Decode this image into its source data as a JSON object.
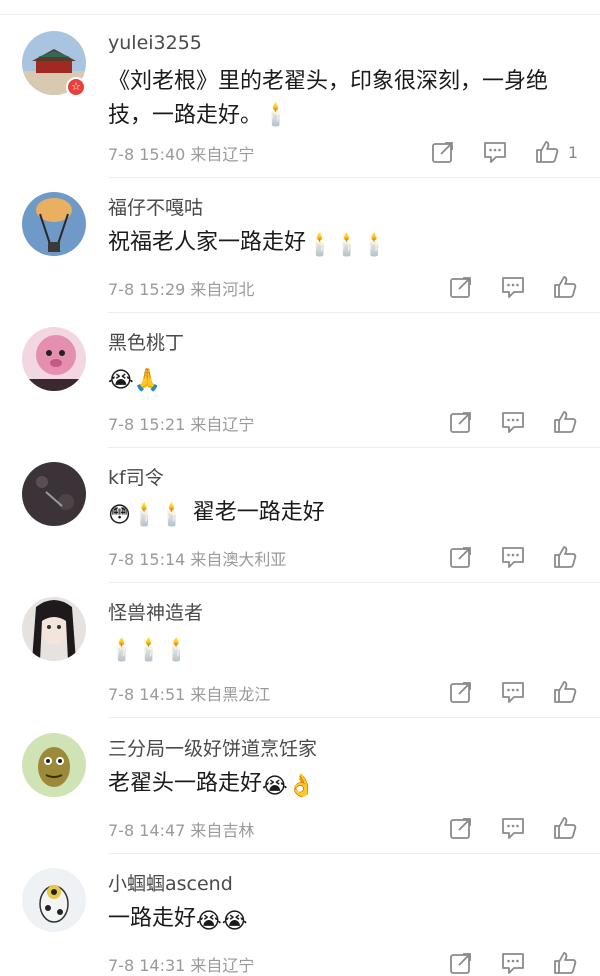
{
  "comments": [
    {
      "username": "yulei3255",
      "text": "《刘老根》里的老翟头，印象很深刻，一身绝技，一路走好。🕯️",
      "time": "7-8 15:40",
      "location": "来自辽宁",
      "likes": "1",
      "avatar_color": "#8fa8c8",
      "has_badge": true,
      "badge_icon": "☆"
    },
    {
      "username": "福仔不嘎咕",
      "text": "祝福老人家一路走好",
      "emojis": "🕯️🕯️🕯️",
      "time": "7-8 15:29",
      "location": "来自河北",
      "likes": "",
      "avatar_color": "#7aa0c8"
    },
    {
      "username": "黑色桃丁",
      "emojis": "😭🙏",
      "time": "7-8 15:21",
      "location": "来自辽宁",
      "likes": "",
      "avatar_color": "#d98fb0"
    },
    {
      "username": "kf司令",
      "emojis": "😳🕯️🕯️",
      "text": "翟老一路走好",
      "time": "7-8 15:14",
      "location": "来自澳大利亚",
      "likes": "",
      "avatar_color": "#3a3438"
    },
    {
      "username": "怪兽神造者",
      "emojis": "🕯️🕯️🕯️",
      "time": "7-8 14:51",
      "location": "来自黑龙江",
      "likes": "",
      "avatar_color": "#d9d5d2"
    },
    {
      "username": "三分局一级好饼道烹饪家",
      "text": "老翟头一路走好",
      "emojis": "😭👌",
      "time": "7-8 14:47",
      "location": "来自吉林",
      "likes": "",
      "avatar_color": "#bcd49a"
    },
    {
      "username": "小蝈蝈ascend",
      "text": "一路走好",
      "emojis": "😭😭",
      "time": "7-8 14:31",
      "location": "来自辽宁",
      "likes": "",
      "avatar_color": "#e8eef2"
    }
  ],
  "icons": {
    "share": "share-icon",
    "comment": "comment-icon",
    "like": "thumbs-up-icon"
  }
}
